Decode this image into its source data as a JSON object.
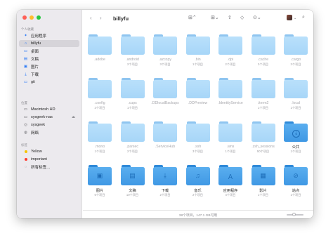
{
  "window": {
    "title": "billyfu"
  },
  "sidebar": {
    "sections": [
      {
        "label": "个人收藏"
      },
      {
        "label": "位置"
      },
      {
        "label": "标签"
      }
    ],
    "favorites": [
      {
        "label": "应用程序",
        "icon": "applications-icon"
      },
      {
        "label": "billyfu",
        "icon": "home-icon",
        "active": true
      },
      {
        "label": "桌面",
        "icon": "desktop-icon"
      },
      {
        "label": "文稿",
        "icon": "documents-icon"
      },
      {
        "label": "图片",
        "icon": "pictures-icon"
      },
      {
        "label": "下载",
        "icon": "downloads-icon"
      },
      {
        "label": "git",
        "icon": "folder-icon"
      }
    ],
    "locations": [
      {
        "label": "Macintosh HD",
        "icon": "disk-icon"
      },
      {
        "label": "sysgeek-nas",
        "icon": "server-icon",
        "eject": true
      },
      {
        "label": "sysgeek",
        "icon": "globe-icon"
      },
      {
        "label": "网络",
        "icon": "network-icon"
      }
    ],
    "tags": [
      {
        "label": "Yellow",
        "color": "#f5c400"
      },
      {
        "label": "important",
        "color": "#ff3b30"
      },
      {
        "label": "所有标签…",
        "icon": "tags-icon"
      }
    ]
  },
  "toolbar": {
    "back": "‹",
    "forward": "›"
  },
  "folders": [
    {
      "name": ".adobe",
      "sub": "",
      "hidden": true
    },
    {
      "name": ".android",
      "sub": "2个项目",
      "hidden": true
    },
    {
      "name": ".azcopy",
      "sub": "3个项目",
      "hidden": true
    },
    {
      "name": ".bin",
      "sub": "1个项目",
      "hidden": true
    },
    {
      "name": ".dpi",
      "sub": "2个项目",
      "hidden": true
    },
    {
      "name": ".cache",
      "sub": "3个项目",
      "hidden": true
    },
    {
      "name": ".cargo",
      "sub": "3个项目",
      "hidden": true
    },
    {
      "name": ".config",
      "sub": "3个项目",
      "hidden": true
    },
    {
      "name": ".cups",
      "sub": "1个项目",
      "hidden": true
    },
    {
      "name": ".DDlocalBackups",
      "sub": "",
      "hidden": true
    },
    {
      "name": ".DDPreview",
      "sub": "",
      "hidden": true
    },
    {
      "name": ".IdentityService",
      "sub": "",
      "hidden": true
    },
    {
      "name": ".iterm2",
      "sub": "1个项目",
      "hidden": true
    },
    {
      "name": ".local",
      "sub": "1个项目",
      "hidden": true
    },
    {
      "name": ".mono",
      "sub": "1个项目",
      "hidden": true
    },
    {
      "name": ".parsec",
      "sub": "2个项目",
      "hidden": true
    },
    {
      "name": ".ServiceHub",
      "sub": "",
      "hidden": true
    },
    {
      "name": ".ssh",
      "sub": "3个项目",
      "hidden": true
    },
    {
      "name": ".wns",
      "sub": "1个项目",
      "hidden": true
    },
    {
      "name": ".zsh_sessions",
      "sub": "50个项目",
      "hidden": true
    },
    {
      "name": "公共",
      "sub": "1个项目",
      "symbol": "⇣",
      "dark": true,
      "circle": true
    },
    {
      "name": "图片",
      "sub": "6个项目",
      "symbol": "▣",
      "dark": true
    },
    {
      "name": "文稿",
      "sub": "10个项目",
      "symbol": "▤",
      "dark": true
    },
    {
      "name": "下载",
      "sub": "2个项目",
      "symbol": "⤓",
      "dark": true
    },
    {
      "name": "音乐",
      "sub": "2个项目",
      "symbol": "♫",
      "dark": true
    },
    {
      "name": "应用程序",
      "sub": "4个项目",
      "symbol": "Ａ",
      "dark": true
    },
    {
      "name": "影片",
      "sub": "1个项目",
      "symbol": "▦",
      "dark": true
    },
    {
      "name": "站点",
      "sub": "1个项目",
      "symbol": "⊘",
      "dark": true
    }
  ],
  "status": {
    "text": "38个项目，147.1 GB可用",
    "icon_size_fraction": 0.45
  }
}
